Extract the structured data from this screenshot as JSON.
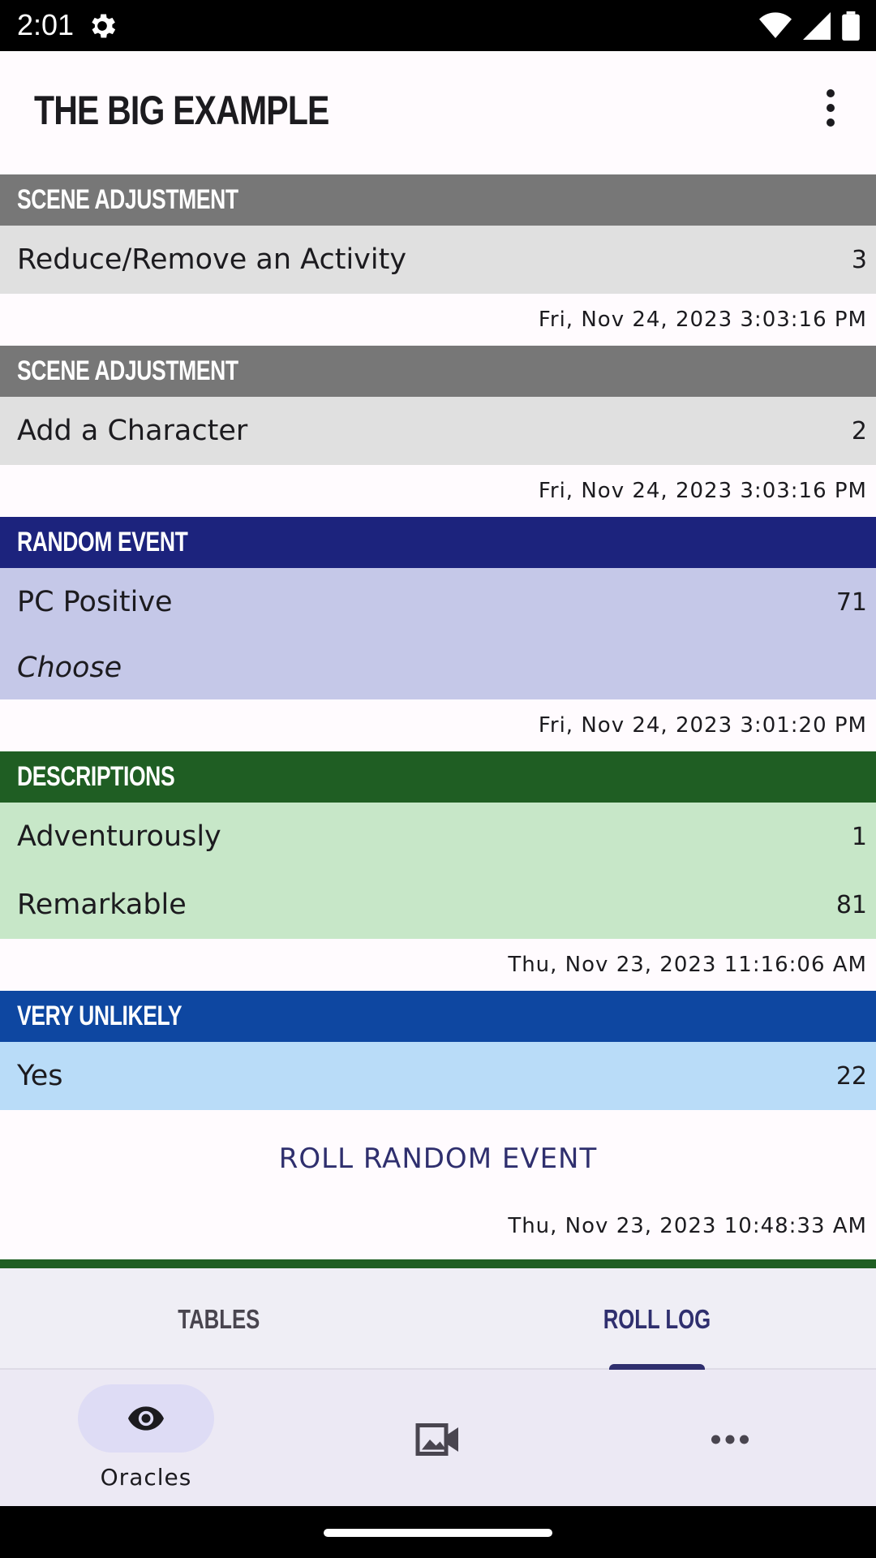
{
  "status": {
    "time": "2:01"
  },
  "app": {
    "title": "THE BIG EXAMPLE"
  },
  "colors": {
    "scene_header": "#777777",
    "scene_body": "#e0e0e0",
    "random_header": "#1c237d",
    "random_body": "#c5c8e8",
    "desc_header": "#1f5e23",
    "desc_body": "#c7e7c8",
    "unlikely_header": "#0e47a1",
    "unlikely_body": "#b9dcf8"
  },
  "entries": [
    {
      "header": "SCENE ADJUSTMENT",
      "rows": [
        {
          "label": "Reduce/Remove an Activity",
          "value": "3"
        }
      ],
      "timestamp": "Fri, Nov 24, 2023 3:03:16 PM"
    },
    {
      "header": "SCENE ADJUSTMENT",
      "rows": [
        {
          "label": "Add a Character",
          "value": "2"
        }
      ],
      "timestamp": "Fri, Nov 24, 2023 3:03:16 PM"
    },
    {
      "header": "RANDOM EVENT",
      "rows": [
        {
          "label": "PC Positive",
          "value": "71"
        }
      ],
      "note": "Choose",
      "timestamp": "Fri, Nov 24, 2023 3:01:20 PM"
    },
    {
      "header": "DESCRIPTIONS",
      "rows": [
        {
          "label": "Adventurously",
          "value": "1"
        },
        {
          "label": "Remarkable",
          "value": "81"
        }
      ],
      "timestamp": "Thu, Nov 23, 2023 11:16:06 AM"
    },
    {
      "header": "VERY UNLIKELY",
      "rows": [
        {
          "label": "Yes",
          "value": "22"
        }
      ],
      "action": "ROLL RANDOM EVENT",
      "timestamp": "Thu, Nov 23, 2023 10:48:33 AM"
    }
  ],
  "tabs": [
    {
      "label": "TABLES",
      "selected": false
    },
    {
      "label": "ROLL LOG",
      "selected": true
    }
  ],
  "bottom_nav": [
    {
      "label": "Oracles",
      "icon": "eye-icon",
      "selected": true
    },
    {
      "label": "",
      "icon": "video-image-icon",
      "selected": false
    },
    {
      "label": "",
      "icon": "more-horiz-icon",
      "selected": false
    }
  ]
}
